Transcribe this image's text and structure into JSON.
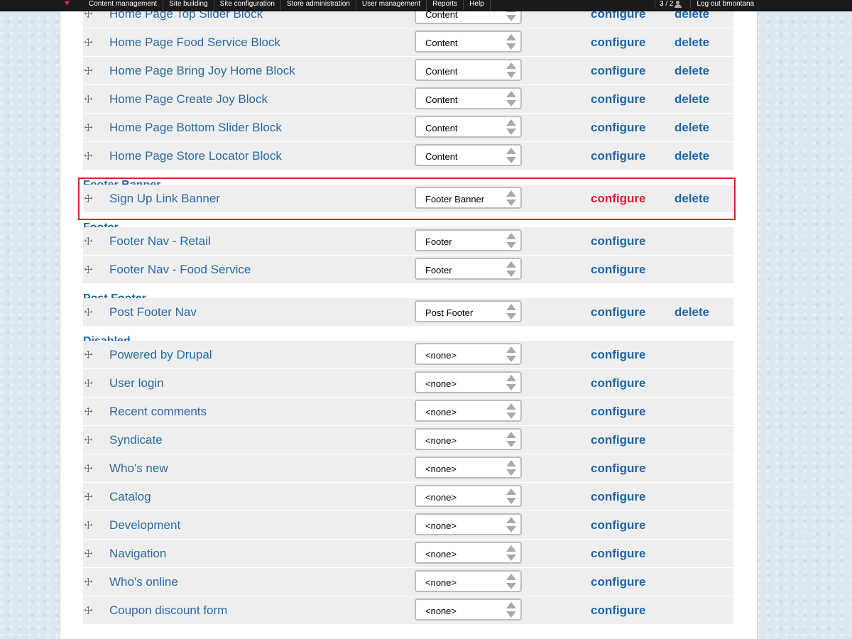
{
  "topbar": {
    "menu": [
      "Content management",
      "Site building",
      "Site configuration",
      "Store administration",
      "User management",
      "Reports",
      "Help"
    ],
    "counter": "3 / 2",
    "logout": "Log out bmontana"
  },
  "colors": {
    "link": "#2a6aa6",
    "action": "#1f66a8",
    "highlight": "#d9232b",
    "row_bg": "#eeeeee"
  },
  "labels": {
    "configure": "configure",
    "delete": "delete"
  },
  "regions": {
    "footer_banner": "Footer Banner",
    "footer": "Footer",
    "post_footer": "Post Footer",
    "disabled": "Disabled"
  },
  "blocks": [
    {
      "name": "Home Page Top Slider Block",
      "region": "Content",
      "delete": true
    },
    {
      "name": "Home Page Food Service Block",
      "region": "Content",
      "delete": true
    },
    {
      "name": "Home Page Bring Joy Home Block",
      "region": "Content",
      "delete": true
    },
    {
      "name": "Home Page Create Joy Block",
      "region": "Content",
      "delete": true
    },
    {
      "name": "Home Page Bottom Slider Block",
      "region": "Content",
      "delete": true
    },
    {
      "name": "Home Page Store Locator Block",
      "region": "Content",
      "delete": true
    },
    {
      "name": "Sign Up Link Banner",
      "region": "Footer Banner",
      "delete": true
    },
    {
      "name": "Footer Nav - Retail",
      "region": "Footer",
      "delete": false
    },
    {
      "name": "Footer Nav - Food Service",
      "region": "Footer",
      "delete": false
    },
    {
      "name": "Post Footer Nav",
      "region": "Post Footer",
      "delete": true
    },
    {
      "name": "Powered by Drupal",
      "region": "<none>",
      "delete": false
    },
    {
      "name": "User login",
      "region": "<none>",
      "delete": false
    },
    {
      "name": "Recent comments",
      "region": "<none>",
      "delete": false
    },
    {
      "name": "Syndicate",
      "region": "<none>",
      "delete": false
    },
    {
      "name": "Who's new",
      "region": "<none>",
      "delete": false
    },
    {
      "name": "Catalog",
      "region": "<none>",
      "delete": false
    },
    {
      "name": "Development",
      "region": "<none>",
      "delete": false
    },
    {
      "name": "Navigation",
      "region": "<none>",
      "delete": false
    },
    {
      "name": "Who's online",
      "region": "<none>",
      "delete": false
    },
    {
      "name": "Coupon discount form",
      "region": "<none>",
      "delete": false
    }
  ]
}
